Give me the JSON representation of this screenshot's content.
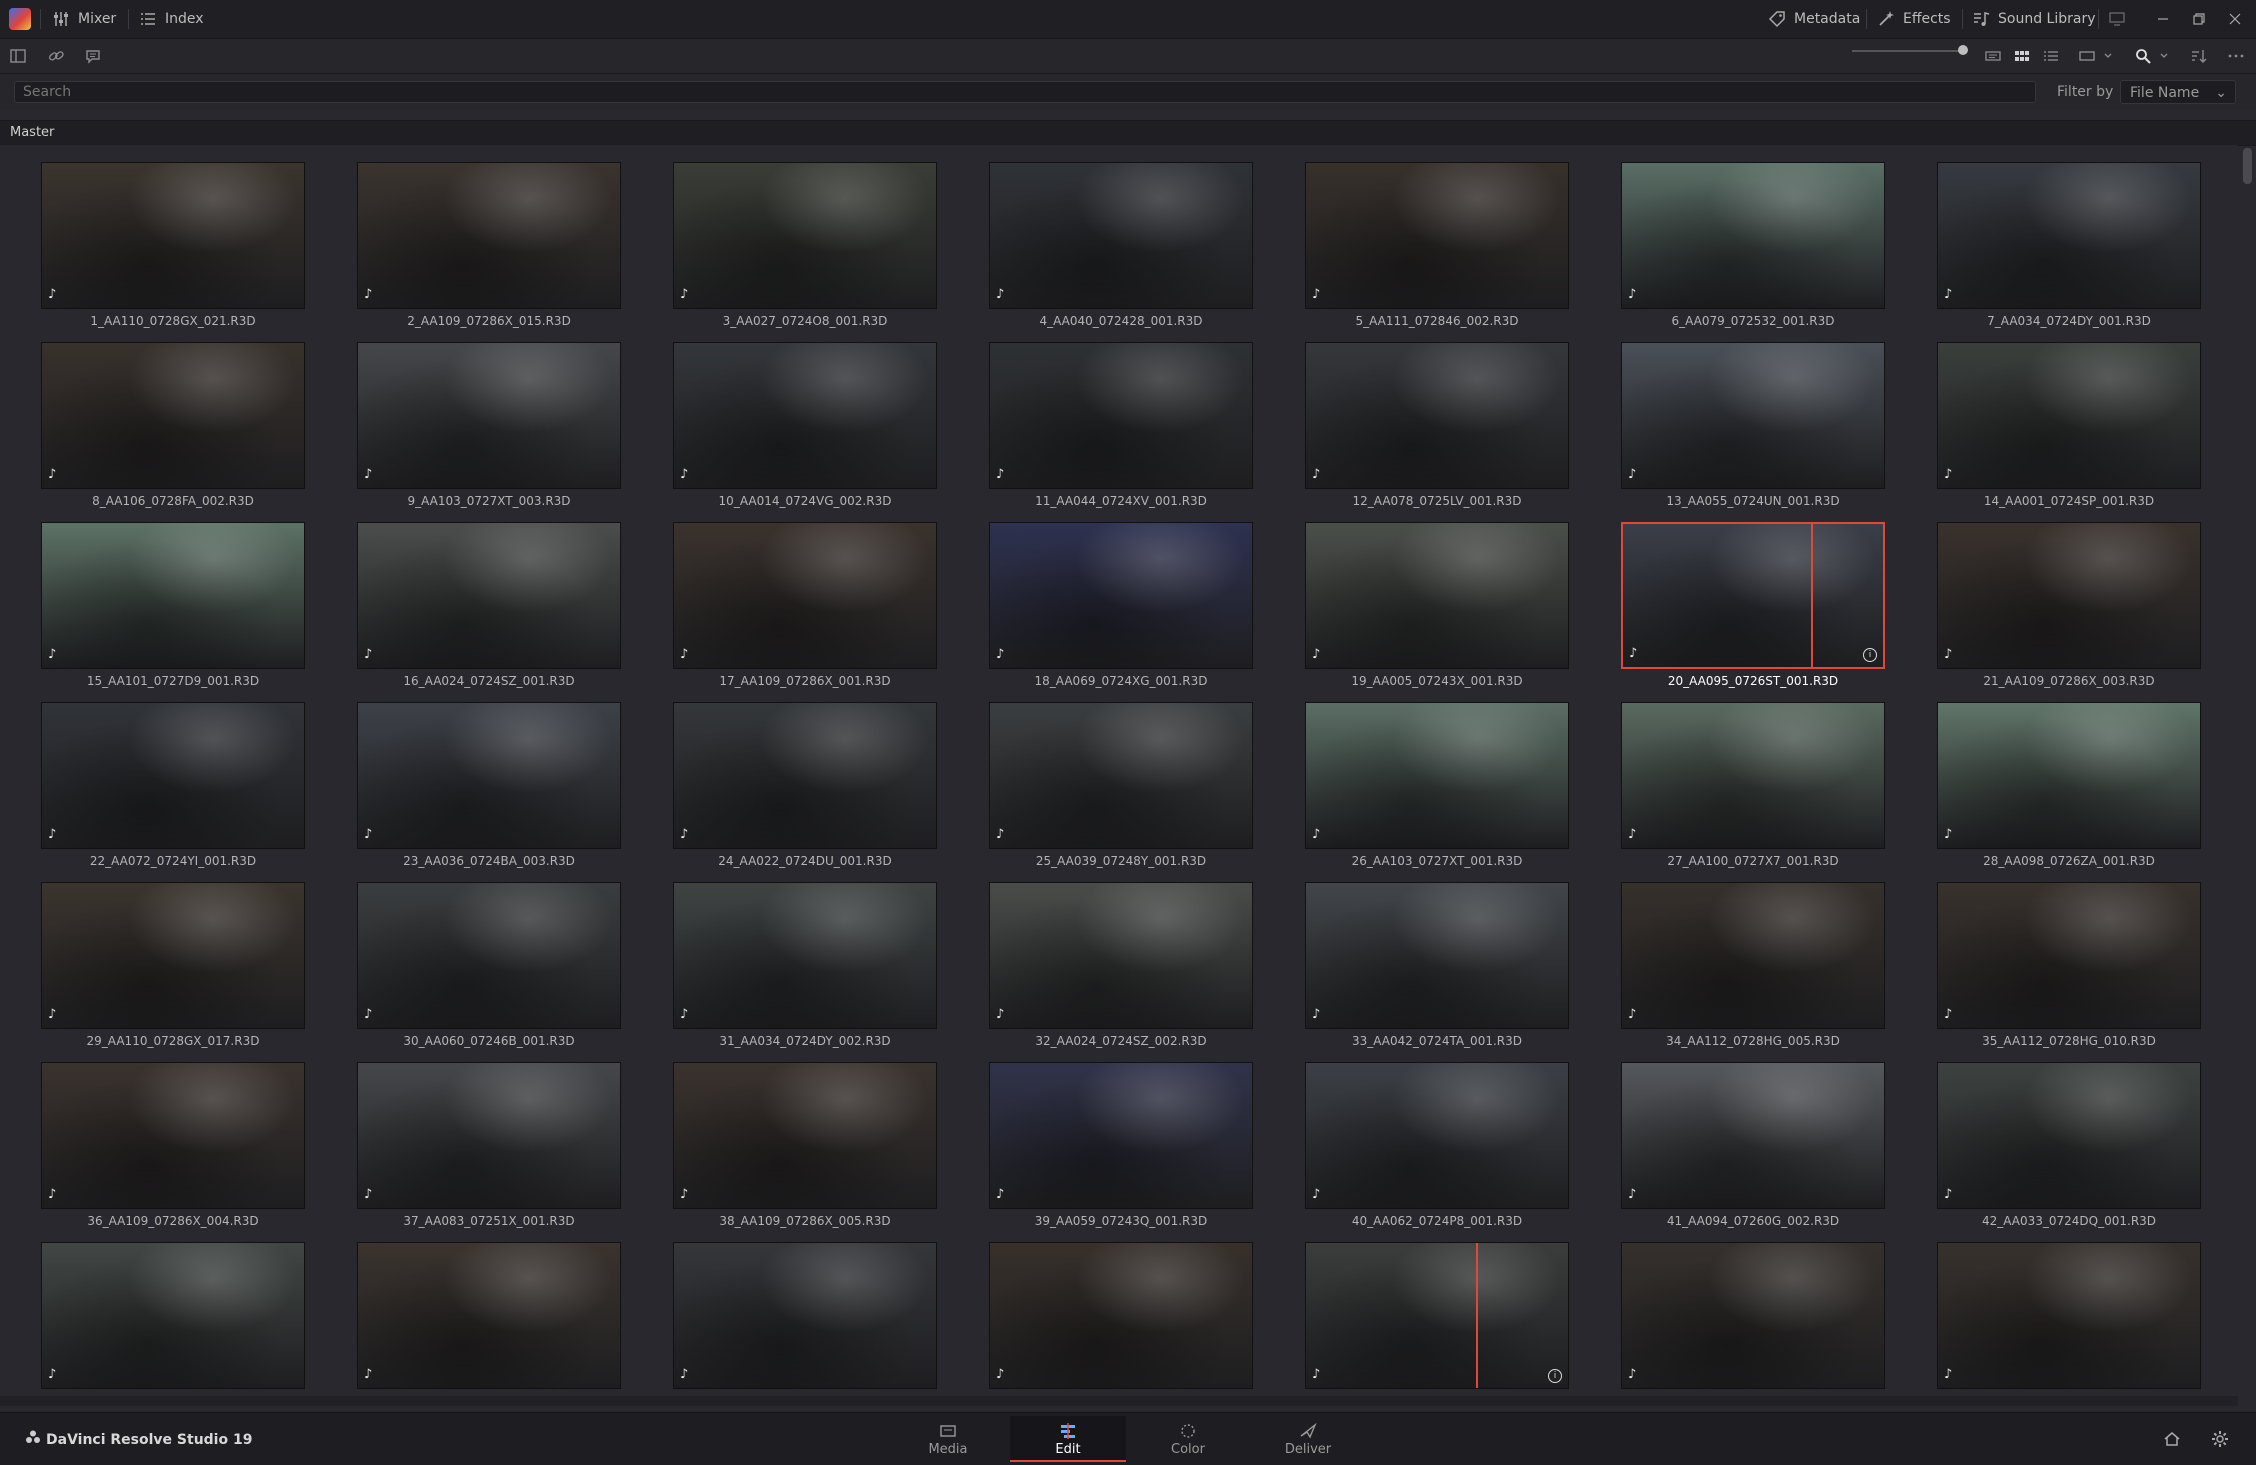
{
  "topbar": {
    "mixer": "Mixer",
    "index": "Index",
    "metadata": "Metadata",
    "effects": "Effects",
    "sound_library": "Sound Library"
  },
  "search": {
    "placeholder": "Search"
  },
  "filter": {
    "label": "Filter by",
    "value": "File Name"
  },
  "breadcrumb": "Master",
  "clips": [
    {
      "name": "1_AA110_0728GX_021.R3D",
      "tone": "#3b342e"
    },
    {
      "name": "2_AA109_07286X_015.R3D",
      "tone": "#3a332e"
    },
    {
      "name": "3_AA027_0724O8_001.R3D",
      "tone": "#3a3d36"
    },
    {
      "name": "4_AA040_072428_001.R3D",
      "tone": "#2f3237"
    },
    {
      "name": "5_AA111_072846_002.R3D",
      "tone": "#37302b"
    },
    {
      "name": "6_AA079_072532_001.R3D",
      "tone": "#5a6e66"
    },
    {
      "name": "7_AA034_0724DY_001.R3D",
      "tone": "#363a40"
    },
    {
      "name": "8_AA106_0728FA_002.R3D",
      "tone": "#38312c"
    },
    {
      "name": "9_AA103_0727XT_003.R3D",
      "tone": "#45474a"
    },
    {
      "name": "10_AA014_0724VG_002.R3D",
      "tone": "#33363a"
    },
    {
      "name": "11_AA044_0724XV_001.R3D",
      "tone": "#2e3134"
    },
    {
      "name": "12_AA078_0725LV_001.R3D",
      "tone": "#35373b"
    },
    {
      "name": "13_AA055_0724UN_001.R3D",
      "tone": "#4a5058"
    },
    {
      "name": "14_AA001_0724SP_001.R3D",
      "tone": "#3a3f3c"
    },
    {
      "name": "15_AA101_0727D9_001.R3D",
      "tone": "#5d7266"
    },
    {
      "name": "16_AA024_0724SZ_001.R3D",
      "tone": "#4a4d4b"
    },
    {
      "name": "17_AA109_07286X_001.R3D",
      "tone": "#3a322d"
    },
    {
      "name": "18_AA069_0724XG_001.R3D",
      "tone": "#2e3150"
    },
    {
      "name": "19_AA005_07243X_001.R3D",
      "tone": "#4b4f4a"
    },
    {
      "name": "20_AA095_0726ST_001.R3D",
      "tone": "#3a3e48"
    },
    {
      "name": "21_AA109_07286X_003.R3D",
      "tone": "#39312c"
    },
    {
      "name": "22_AA072_0724YI_001.R3D",
      "tone": "#303338"
    },
    {
      "name": "23_AA036_0724BA_003.R3D",
      "tone": "#3d4148"
    },
    {
      "name": "24_AA022_0724DU_001.R3D",
      "tone": "#34373a"
    },
    {
      "name": "25_AA039_07248Y_001.R3D",
      "tone": "#3b3e40"
    },
    {
      "name": "26_AA103_0727XT_001.R3D",
      "tone": "#5b6e65"
    },
    {
      "name": "27_AA100_0727X7_001.R3D",
      "tone": "#5a6a60"
    },
    {
      "name": "28_AA098_0726ZA_001.R3D",
      "tone": "#607569"
    },
    {
      "name": "29_AA110_0728GX_017.R3D",
      "tone": "#3b342e"
    },
    {
      "name": "30_AA060_07246B_001.R3D",
      "tone": "#3a3d3f"
    },
    {
      "name": "31_AA034_0724DY_002.R3D",
      "tone": "#3f4443"
    },
    {
      "name": "32_AA024_0724SZ_002.R3D",
      "tone": "#4a4c4a"
    },
    {
      "name": "33_AA042_0724TA_001.R3D",
      "tone": "#42464a"
    },
    {
      "name": "34_AA112_0728HG_005.R3D",
      "tone": "#36302b"
    },
    {
      "name": "35_AA112_0728HG_010.R3D",
      "tone": "#38312c"
    },
    {
      "name": "36_AA109_07286X_004.R3D",
      "tone": "#3a322d"
    },
    {
      "name": "37_AA083_07251X_001.R3D",
      "tone": "#45474a"
    },
    {
      "name": "38_AA109_07286X_005.R3D",
      "tone": "#3a322d"
    },
    {
      "name": "39_AA059_07243Q_001.R3D",
      "tone": "#30334a"
    },
    {
      "name": "40_AA062_0724P8_001.R3D",
      "tone": "#3c4046"
    },
    {
      "name": "41_AA094_07260G_002.R3D",
      "tone": "#55585c"
    },
    {
      "name": "42_AA033_0724DQ_001.R3D",
      "tone": "#3d4240"
    },
    {
      "name": "",
      "tone": "#414744"
    },
    {
      "name": "",
      "tone": "#3a332e"
    },
    {
      "name": "",
      "tone": "#35363a"
    },
    {
      "name": "",
      "tone": "#37302b"
    },
    {
      "name": "",
      "tone": "#3a3d3c"
    },
    {
      "name": "",
      "tone": "#35302c"
    },
    {
      "name": "",
      "tone": "#37312c"
    }
  ],
  "selected_clip_index": 19,
  "bottombar": {
    "app_name": "DaVinci Resolve Studio 19",
    "pages": [
      "Media",
      "Edit",
      "Color",
      "Deliver"
    ],
    "active_page": "Edit"
  },
  "colors": {
    "accent": "#e0483c"
  }
}
